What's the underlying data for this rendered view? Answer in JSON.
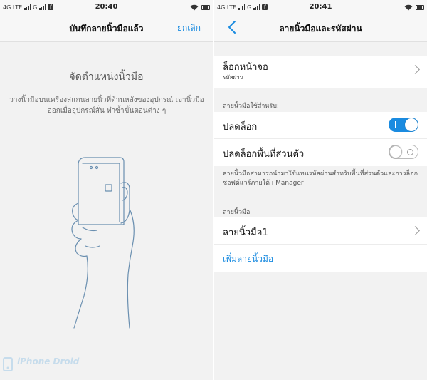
{
  "left": {
    "status": {
      "network": "4G LTE",
      "carrier2": "G",
      "fb": "f",
      "time": "20:40"
    },
    "header": {
      "title": "บันทึกลายนิ้วมือแล้ว",
      "cancel": "ยกเลิก"
    },
    "instruction_title": "จัดตำแหน่งนิ้วมือ",
    "instruction_text": "วางนิ้วมือบนเครื่องสแกนลายนิ้วที่ด้านหลังของอุปกรณ์ เอานิ้วมือออกเมื่ออุปกรณ์สั่น ทำซ้ำขั้นตอนต่าง ๆ",
    "watermark": "iPhone Droid"
  },
  "right": {
    "status": {
      "network": "4G LTE",
      "carrier2": "G",
      "fb": "f",
      "time": "20:41"
    },
    "header": {
      "title": "ลายนิ้วมือและรหัสผ่าน"
    },
    "screen_lock": {
      "title": "ล็อกหน้าจอ",
      "subtitle": "รหัสผ่าน"
    },
    "use_for_label": "ลายนิ้วมือใช้สำหรับ:",
    "unlock": {
      "label": "ปลดล็อก",
      "enabled": true
    },
    "private_unlock": {
      "label": "ปลดล็อกพื้นที่ส่วนตัว",
      "enabled": false
    },
    "note": "ลายนิ้วมือสามารถนำมาใช้แทนรหัสผ่านสำหรับพื้นที่ส่วนตัวและการล็อกซอฟต์แวร์ภายใต้ i Manager",
    "fingerprints_label": "ลายนิ้วมือ",
    "fingerprint1": "ลายนิ้วมือ1",
    "add_fingerprint": "เพิ่มลายนิ้วมือ"
  },
  "colors": {
    "accent": "#1a8be0",
    "background": "#f2f2f2"
  }
}
